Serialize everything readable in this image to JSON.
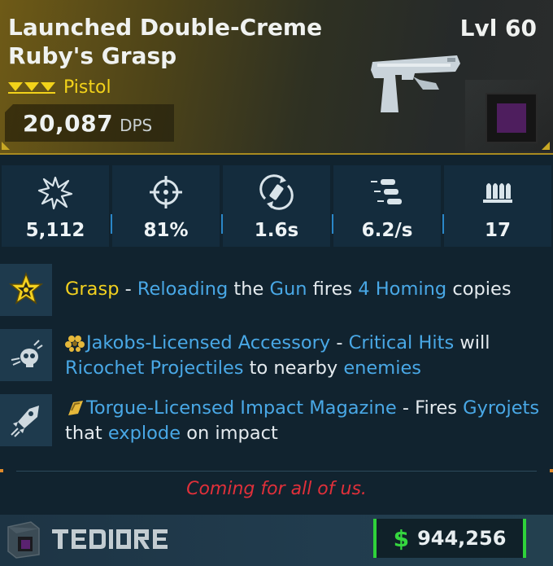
{
  "item": {
    "name": "Launched Double-Creme Ruby's Grasp",
    "level": "Lvl 60",
    "weapon_type": "Pistol",
    "dps_value": "20,087",
    "dps_unit": "DPS",
    "rarity_color": "#f2d21a",
    "element_color": "#4e1e5e"
  },
  "stats": [
    {
      "icon": "damage-burst-icon",
      "value": "5,112"
    },
    {
      "icon": "crosshair-accuracy-icon",
      "value": "81%"
    },
    {
      "icon": "reload-magazine-icon",
      "value": "1.6s"
    },
    {
      "icon": "fire-rate-bullets-icon",
      "value": "6.2/s"
    },
    {
      "icon": "magazine-ammo-icon",
      "value": "17"
    }
  ],
  "perks": [
    {
      "icon": "grasp-star-icon",
      "title": "Grasp",
      "sep1": " - ",
      "k1": "Reloading",
      "t1": " the ",
      "k2": "Gun",
      "t2": " fires ",
      "k3": "4 Homing",
      "t3": " copies"
    },
    {
      "icon": "skull-ricochet-icon",
      "inline_icon": "jakobs-emblem-icon",
      "title": "Jakobs-Licensed Accessory",
      "sep1": " - ",
      "k1": "Critical Hits",
      "t1": " will ",
      "k2": "Ricochet Projectiles",
      "t2": " to nearby ",
      "k3": "enemies"
    },
    {
      "icon": "rocket-gyrojet-icon",
      "inline_icon": "torgue-emblem-icon",
      "title": "Torgue-Licensed Impact Magazine",
      "sep1": " - Fires ",
      "k1": "Gyrojets",
      "t1": " that ",
      "k2": "explode",
      "t2": " on impact"
    }
  ],
  "flavor_text": "Coming for all of us.",
  "manufacturer": "TEDIORE",
  "price": {
    "symbol": "$",
    "value": "944,256"
  },
  "colors": {
    "accent_blue": "#49a8e6",
    "legendary_yellow": "#f3d11f",
    "flavor_red": "#e0303a",
    "money_green": "#2fd23a"
  }
}
